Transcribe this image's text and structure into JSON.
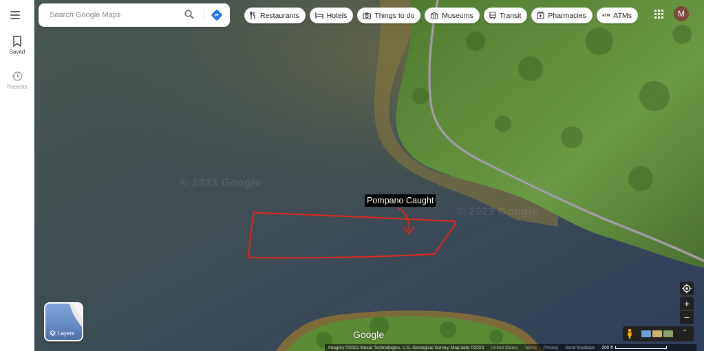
{
  "search": {
    "placeholder": "Search Google Maps"
  },
  "rail": {
    "saved_label": "Saved",
    "recents_label": "Recents"
  },
  "chips": [
    {
      "label": "Restaurants",
      "icon": "fork-knife-icon"
    },
    {
      "label": "Hotels",
      "icon": "bed-icon"
    },
    {
      "label": "Things to do",
      "icon": "camera-icon"
    },
    {
      "label": "Museums",
      "icon": "museum-icon"
    },
    {
      "label": "Transit",
      "icon": "bus-icon"
    },
    {
      "label": "Pharmacies",
      "icon": "pharmacy-icon"
    },
    {
      "label": "ATMs",
      "icon": "atm-icon"
    }
  ],
  "atm_icon_text": "ATM",
  "account": {
    "initial": "M",
    "color": "#7b4a3a"
  },
  "annotation": {
    "text": "Pompano Caught",
    "stroke_color": "#e0261e"
  },
  "watermarks": [
    "© 2023 Google",
    "© 2023 Google"
  ],
  "layers": {
    "label": "Layers"
  },
  "brand": {
    "logo_text": "Google"
  },
  "footer": {
    "attribution": "Imagery ©2023 Maxar Technologies, U.S. Geological Survey, Map data ©2023",
    "country": "United States",
    "terms": "Terms",
    "privacy": "Privacy",
    "feedback": "Send feedback",
    "scale": "200 ft"
  },
  "controls": {
    "zoom_in": "+",
    "zoom_out": "−"
  },
  "colors": {
    "water": "#3b4a57",
    "vegetation": "#5e8a3c",
    "sand": "#b08a3a"
  }
}
